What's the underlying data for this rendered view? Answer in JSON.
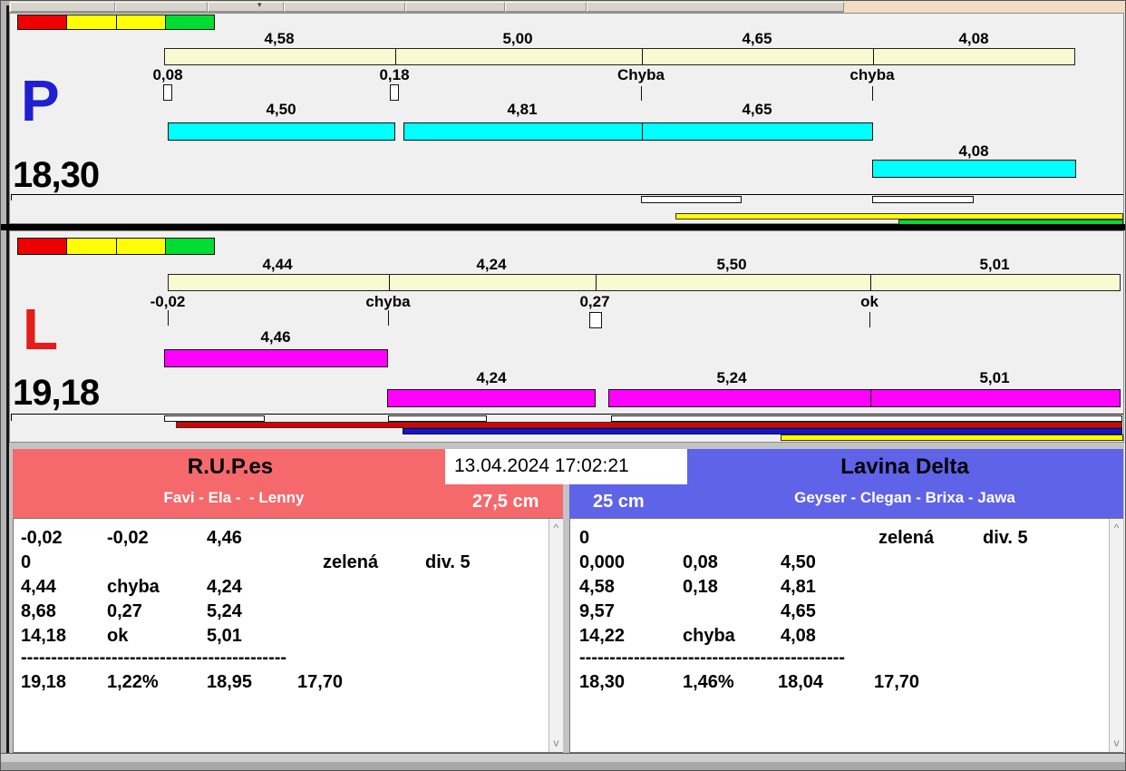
{
  "toolbar": {
    "caret_icon": "▾"
  },
  "colors": {
    "status_squares": [
      "#ee0000",
      "#ffff00",
      "#ffff00",
      "#00dd32"
    ],
    "bar_cyan": "#00ffff",
    "bar_magenta": "#ff00ff",
    "ruler_fill": "#fafad2",
    "left_header": "#f5696c",
    "right_header": "#5f63e8",
    "letter_p": "#1f1fd0",
    "letter_l": "#e41c1c"
  },
  "panel_p": {
    "letter": "P",
    "total": "18,30",
    "ruler_segments": [
      "4,58",
      "5,00",
      "4,65",
      "4,08"
    ],
    "ticks": [
      "0,08",
      "0,18",
      "Chyba",
      "chyba"
    ],
    "bar_labels": [
      "4,50",
      "4,81",
      "4,65",
      "4,08"
    ]
  },
  "panel_l": {
    "letter": "L",
    "total": "19,18",
    "ruler_segments": [
      "4,44",
      "4,24",
      "5,50",
      "5,01"
    ],
    "ticks": [
      "-0,02",
      "chyba",
      "0,27",
      "ok"
    ],
    "bar_labels": [
      "4,46",
      "4,24",
      "5,24",
      "5,01"
    ]
  },
  "results": {
    "timestamp": "13.04.2024 17:02:21",
    "left": {
      "title": "R.U.P.es",
      "team": "Favi - Ela -  - Lenny",
      "width_cm": "27,5 cm",
      "rows": [
        [
          "-0,02",
          "-0,02",
          "4,46"
        ],
        [
          "0",
          "zelená",
          "div. 5"
        ],
        [
          "4,44",
          "chyba",
          "4,24"
        ],
        [
          "8,68",
          "0,27",
          "5,24"
        ],
        [
          "14,18",
          "ok",
          "5,01"
        ]
      ],
      "dashes": "--------------------------------------------",
      "totals": [
        "19,18",
        "1,22%",
        "18,95",
        "17,70"
      ]
    },
    "right": {
      "title": "Lavina Delta",
      "team": "Geyser - Clegan - Brixa - Jawa",
      "width_cm": "25 cm",
      "rows": [
        [
          "0",
          "zelená",
          "div. 5"
        ],
        [
          "0,000",
          "0,08",
          "4,50"
        ],
        [
          "4,58",
          "0,18",
          "4,81"
        ],
        [
          "9,57",
          "",
          "4,65"
        ],
        [
          "14,22",
          "chyba",
          "4,08"
        ]
      ],
      "dashes": "--------------------------------------------",
      "totals": [
        "18,30",
        "1,46%",
        "18,04",
        "17,70"
      ]
    }
  }
}
